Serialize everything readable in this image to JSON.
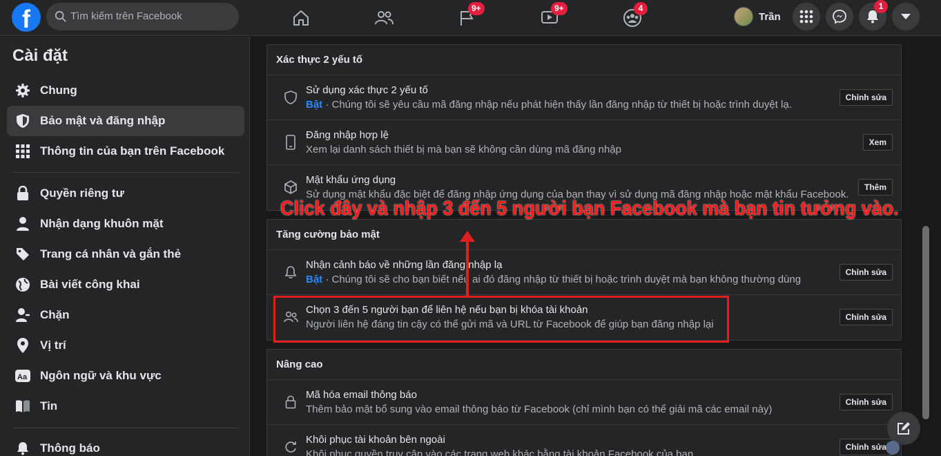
{
  "header": {
    "logo_letter": "f",
    "search_placeholder": "Tìm kiếm trên Facebook",
    "badges": {
      "groups": "9+",
      "watch": "9+",
      "gaming": "4",
      "notifications": "1"
    },
    "profile_name": "Trần"
  },
  "sidebar": {
    "title": "Cài đặt",
    "items": [
      {
        "label": "Chung"
      },
      {
        "label": "Bảo mật và đăng nhập"
      },
      {
        "label": "Thông tin của bạn trên Facebook"
      },
      {
        "label": "Quyền riêng tư"
      },
      {
        "label": "Nhận dạng khuôn mặt"
      },
      {
        "label": "Trang cá nhân và gắn thẻ"
      },
      {
        "label": "Bài viết công khai"
      },
      {
        "label": "Chặn"
      },
      {
        "label": "Vị trí"
      },
      {
        "label": "Ngôn ngữ và khu vực"
      },
      {
        "label": "Tin"
      },
      {
        "label": "Thông báo"
      }
    ]
  },
  "sections": {
    "two_factor": {
      "title": "Xác thực 2 yếu tố",
      "rows": [
        {
          "title": "Sử dụng xác thực 2 yếu tố",
          "status": "Bật",
          "desc": " · Chúng tôi sẽ yêu cầu mã đăng nhập nếu phát hiện thấy lần đăng nhập từ thiết bị hoặc trình duyệt lạ.",
          "button": "Chỉnh sửa"
        },
        {
          "title": "Đăng nhập hợp lệ",
          "desc": "Xem lại danh sách thiết bị mà bạn sẽ không cần dùng mã đăng nhập",
          "button": "Xem"
        },
        {
          "title": "Mật khẩu ứng dụng",
          "desc": "Sử dụng mật khẩu đặc biệt để đăng nhập ứng dụng của bạn thay vì sử dụng mã đăng nhập hoặc mật khẩu Facebook.",
          "button": "Thêm"
        }
      ]
    },
    "extra_security": {
      "title": "Tăng cường bảo mật",
      "rows": [
        {
          "title": "Nhận cảnh báo về những lần đăng nhập lạ",
          "status": "Bật",
          "desc": " · Chúng tôi sẽ cho bạn biết nếu ai đó đăng nhập từ thiết bị hoặc trình duyệt mà bạn không thường dùng",
          "button": "Chỉnh sửa"
        },
        {
          "title": "Chọn 3 đến 5 người bạn để liên hệ nếu bạn bị khóa tài khoản",
          "desc": "Người liên hệ đáng tin cậy có thể gửi mã và URL từ Facebook để giúp bạn đăng nhập lại",
          "button": "Chỉnh sửa"
        }
      ]
    },
    "advanced": {
      "title": "Nâng cao",
      "rows": [
        {
          "title": "Mã hóa email thông báo",
          "desc": "Thêm bảo mật bổ sung vào email thông báo từ Facebook (chỉ mình bạn có thể giải mã các email này)",
          "button": "Chỉnh sửa"
        },
        {
          "title": "Khôi phục tài khoản bên ngoài",
          "desc": "Khôi phục quyền truy cập vào các trang web khác bằng tài khoản Facebook của bạn",
          "button": "Chỉnh sửa"
        }
      ]
    }
  },
  "annotation": {
    "text": "Click đây và nhập 3 đến 5 người bạn Facebook mà bạn tin tưởng vào.",
    "color": "#ff1a1a"
  },
  "colors": {
    "accent": "#1877f2",
    "link": "#2d88ff",
    "badge": "#e41e3f"
  }
}
